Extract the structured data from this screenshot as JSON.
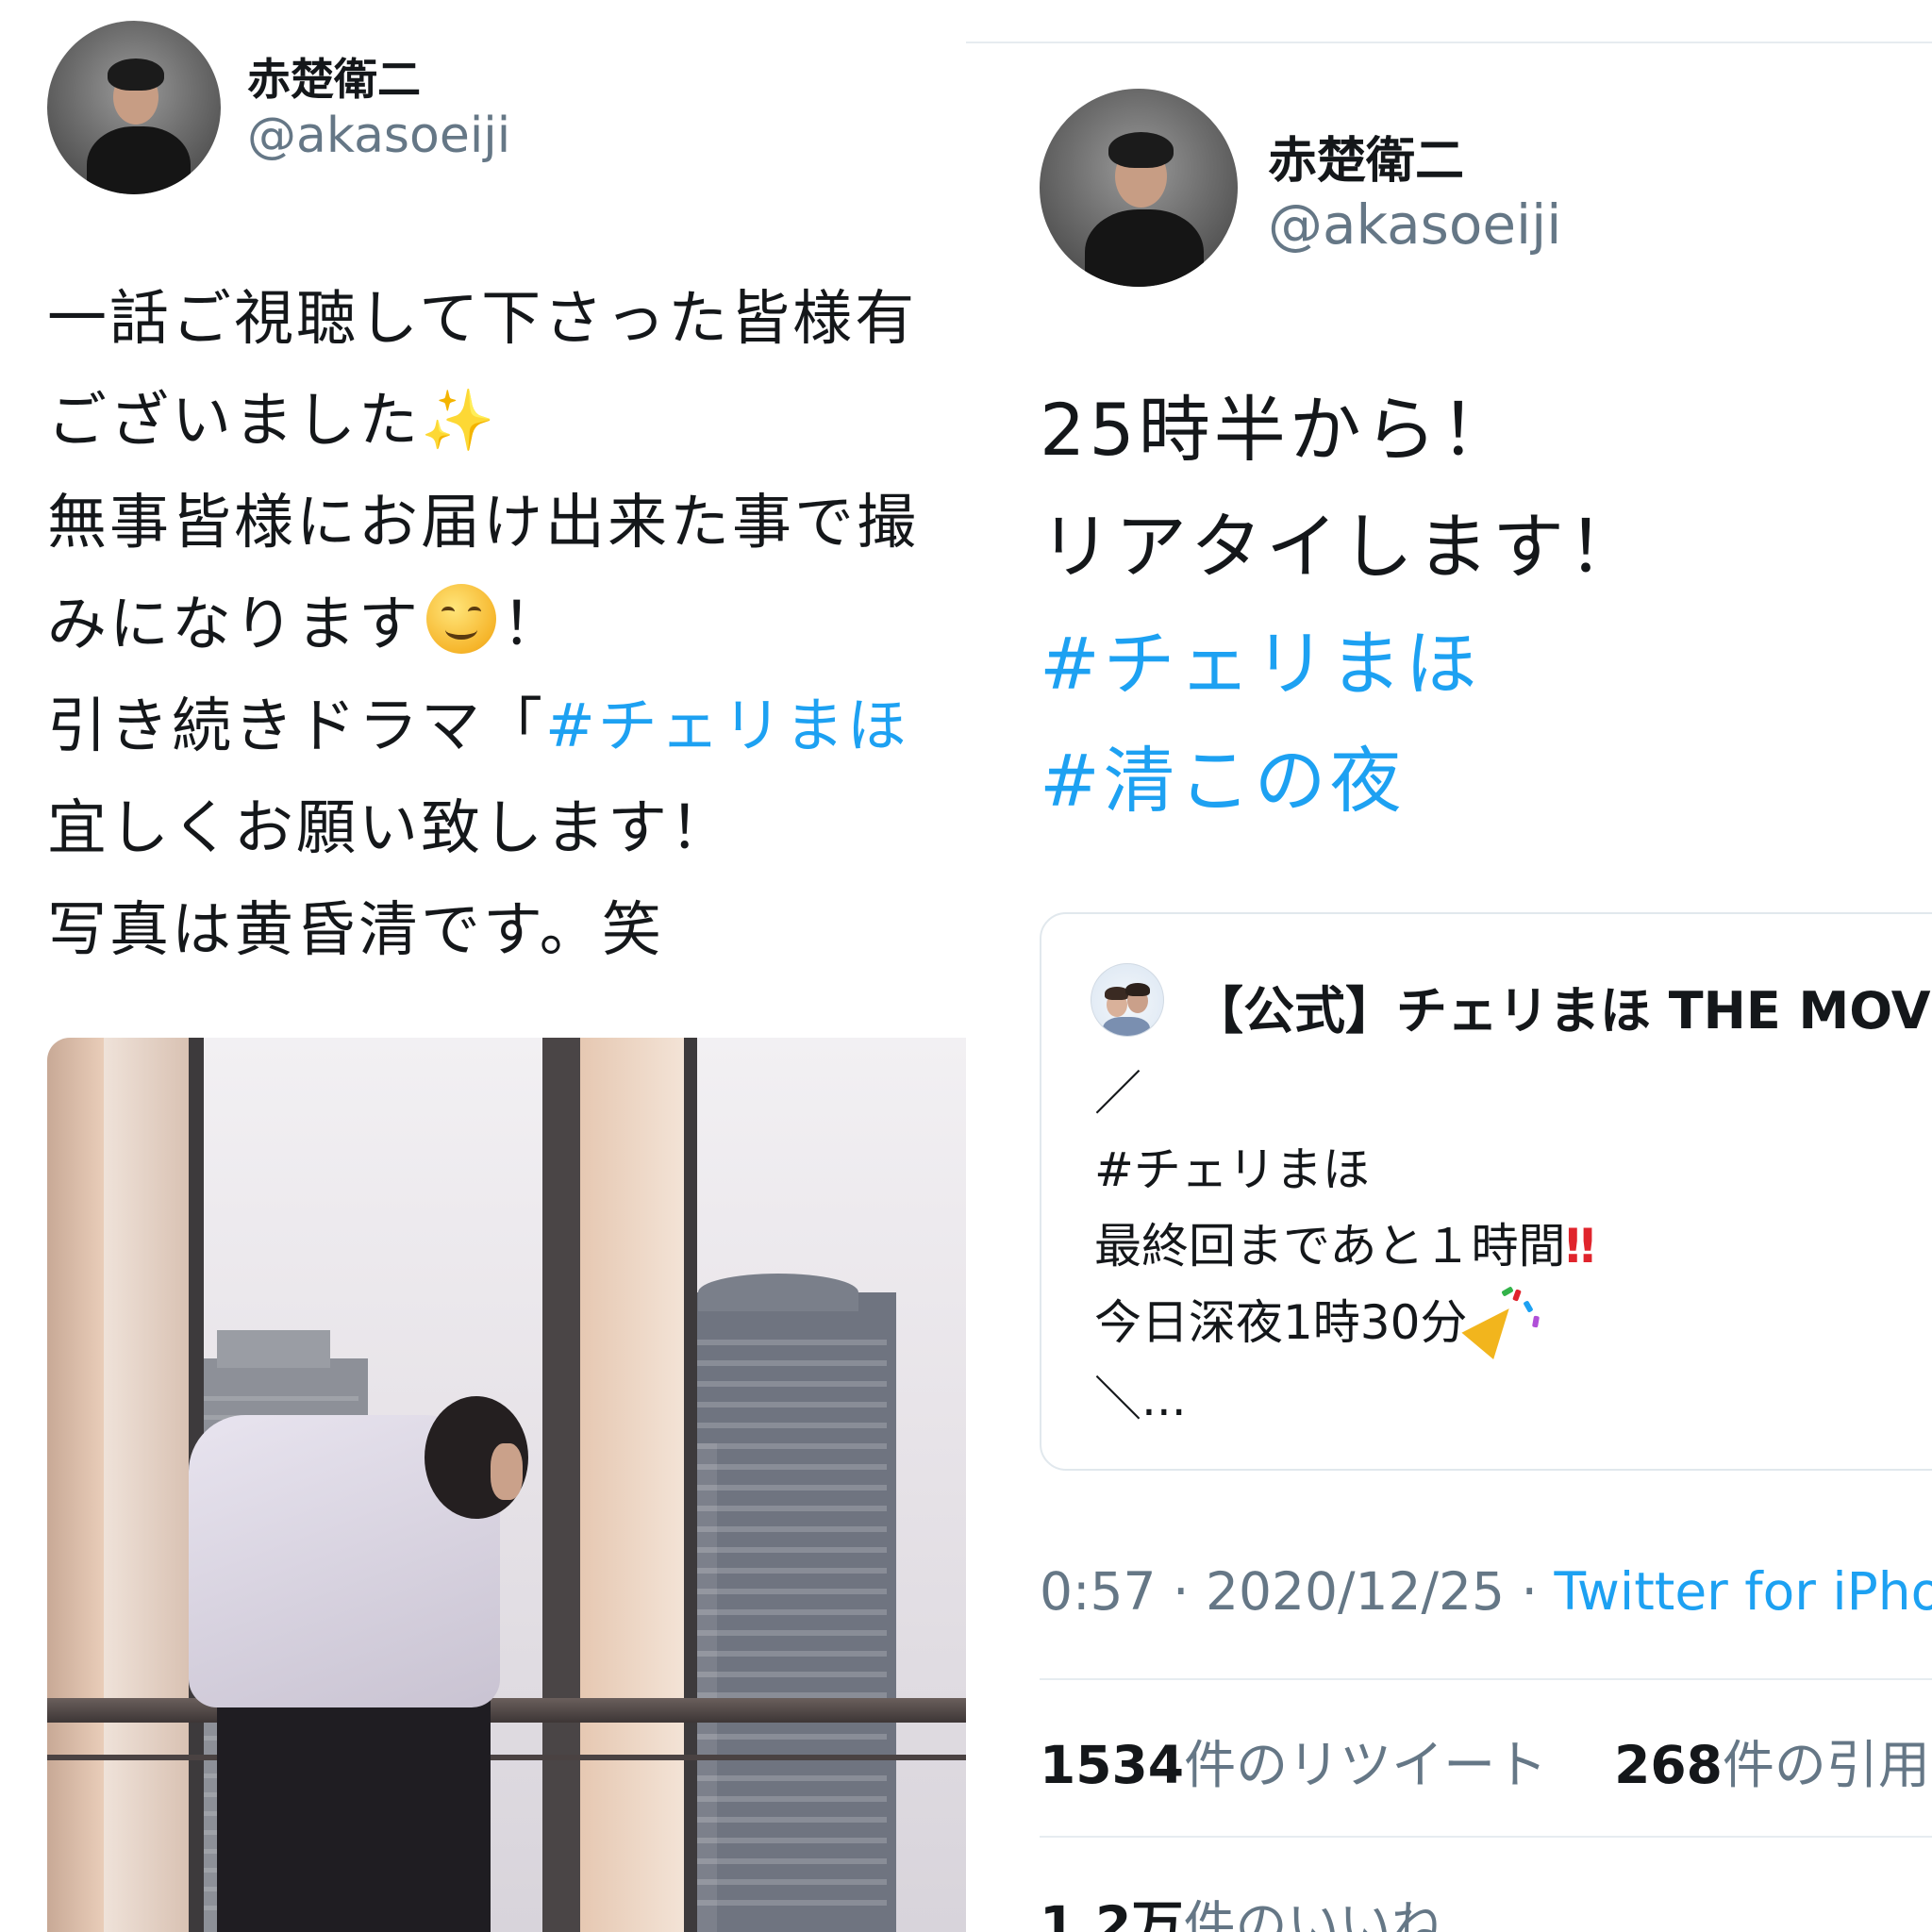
{
  "left_tweet": {
    "author_name": "赤楚衛二",
    "author_handle": "@akasoeiji",
    "lines": {
      "l1": "一話ご視聴して下さった皆様有",
      "l2": "ございました",
      "l3": "無事皆様にお届け出来た事で撮",
      "l4": "みになります",
      "l4_end": "！",
      "l5_prefix": "引き続きドラマ「",
      "l5_hashtag": "#チェリまほ",
      "l6": "宜しくお願い致します！",
      "l7": "写真は黄昏清です。笑"
    },
    "emoji": {
      "sparkles": "sparkles-icon",
      "smile": "smiling-face-icon"
    }
  },
  "right_tweet": {
    "author_name": "赤楚衛二",
    "author_handle": "@akasoeiji",
    "line1": "25時半から！",
    "line2": "リアタイします！",
    "hashtag1": "#チェリまほ",
    "hashtag2": "#清この夜",
    "quoted": {
      "name": "【公式】チェリまほ THE MOV",
      "line1": "／",
      "line2": "#チェリまほ",
      "line3": "最終回まであと１時間",
      "line4": "今日深夜1時30分",
      "line5": "＼...",
      "emoji": {
        "double_exclamation": "‼",
        "party": "party-popper-icon"
      }
    },
    "time": "0:57",
    "date": "2020/12/25",
    "separator": " · ",
    "source": "Twitter for iPho",
    "retweets_count": "1534",
    "retweets_label": "件のリツイート",
    "quotes_count": "268",
    "quotes_label": "件の引用ツ",
    "likes_count": "1.2万",
    "likes_label": "件のいいね"
  },
  "colors": {
    "text": "#14171a",
    "secondary": "#657786",
    "link": "#1da1f2",
    "border": "#e1e8ed",
    "alert": "#e0242c"
  }
}
